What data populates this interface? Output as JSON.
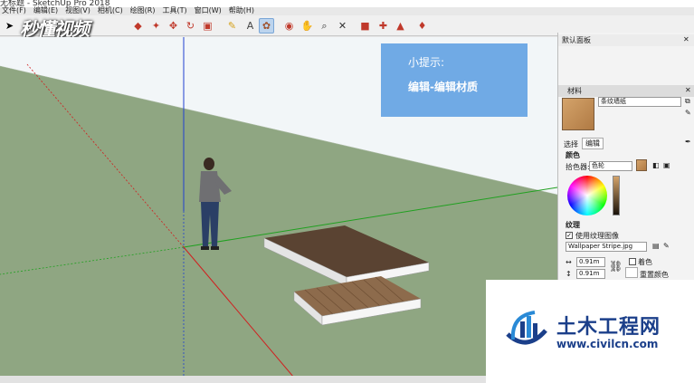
{
  "window": {
    "title": "无标题 - SketchUp Pro 2018"
  },
  "menu": [
    "文件(F)",
    "编辑(E)",
    "视图(V)",
    "相机(C)",
    "绘图(R)",
    "工具(T)",
    "窗口(W)",
    "帮助(H)"
  ],
  "toolbar": {
    "tools": [
      {
        "icon": "select-arrow-icon"
      },
      {
        "icon": "paint-bucket-icon"
      },
      {
        "icon": "push-pull-icon"
      },
      {
        "icon": "move-icon"
      },
      {
        "icon": "rotate-icon"
      },
      {
        "icon": "scale-icon"
      },
      {
        "icon": "tape-measure-icon"
      },
      {
        "icon": "text-icon"
      },
      {
        "icon": "paint-icon"
      },
      {
        "icon": "orbit-icon"
      },
      {
        "icon": "pan-icon"
      },
      {
        "icon": "zoom-icon"
      },
      {
        "icon": "zoom-extents-icon"
      },
      {
        "icon": "warehouse-icon"
      },
      {
        "icon": "extension-icon"
      },
      {
        "icon": "share-icon"
      },
      {
        "icon": "ruby-icon"
      }
    ]
  },
  "logo": {
    "text": "秒懂视频"
  },
  "hint": {
    "title": "小提示:",
    "body": "编辑-编辑材质"
  },
  "panel": {
    "tray_title": "默认面板",
    "materials": {
      "header": "材料",
      "material_name": "条纹墙纸",
      "tabs": {
        "select": "选择",
        "edit": "编辑"
      },
      "color_section": "颜色",
      "picker_label": "拾色器:",
      "picker_value": "色轮",
      "texture_section": "纹理",
      "use_texture_label": "使用纹理图像",
      "texture_file": "Wallpaper Stripe.jpg",
      "width_value": "0.91m",
      "height_value": "0.91m",
      "colorize_label": "着色",
      "reset_color_label": "重置颜色"
    }
  },
  "brand": {
    "name": "土木工程网",
    "url": "www.civilcn.com"
  },
  "colors": {
    "sky": "#f2f6f8",
    "ground": "#8fa682",
    "hint_bg": "#6aa6e4",
    "brand_blue": "#1b3f8a"
  }
}
